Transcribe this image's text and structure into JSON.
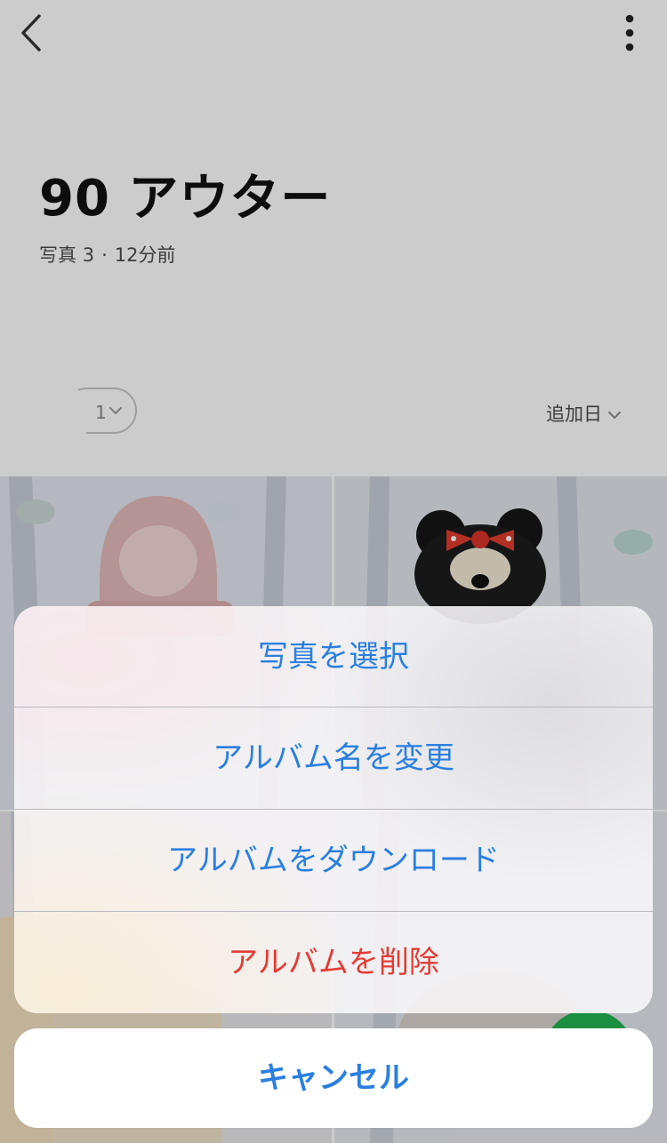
{
  "header": {
    "back_icon": "chevron-left-icon",
    "more_icon": "more-vertical-icon"
  },
  "album": {
    "title": "90 アウター",
    "photo_label": "写真",
    "photo_count": "3",
    "separator": "·",
    "updated": "12分前"
  },
  "members": {
    "count": "1"
  },
  "sort": {
    "label": "追加日"
  },
  "action_sheet": {
    "items": [
      {
        "label": "写真を選択",
        "style": "default"
      },
      {
        "label": "アルバム名を変更",
        "style": "default"
      },
      {
        "label": "アルバムをダウンロード",
        "style": "default"
      },
      {
        "label": "アルバムを削除",
        "style": "destructive"
      }
    ],
    "cancel_label": "キャンセル"
  },
  "colors": {
    "action_blue": "#2a7fe0",
    "destructive_red": "#e23c36",
    "fab_green": "#21b252"
  }
}
